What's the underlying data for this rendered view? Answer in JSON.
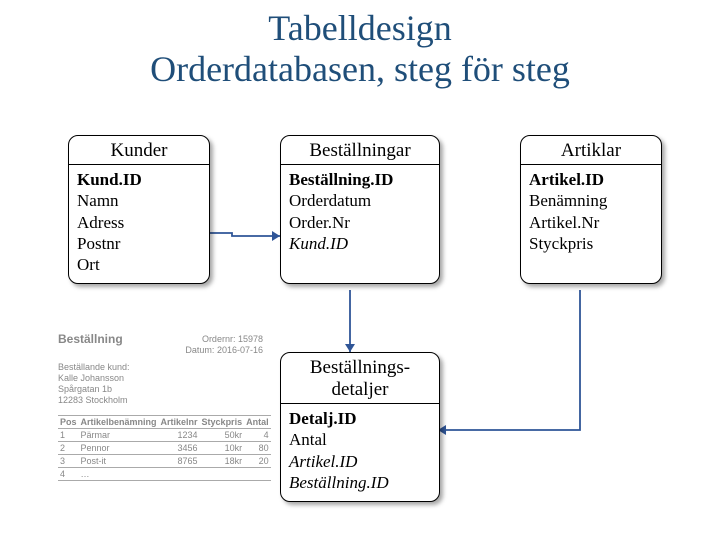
{
  "title_line1": "Tabelldesign",
  "title_line2": "Orderdatabasen, steg för steg",
  "boxes": {
    "kunder": {
      "title": "Kunder",
      "fields": [
        "Kund.ID",
        "Namn",
        "Adress",
        "Postnr",
        "Ort"
      ]
    },
    "bestallningar": {
      "title": "Beställningar",
      "fields": [
        "Beställning.ID",
        "Orderdatum",
        "Order.Nr",
        "Kund.ID"
      ]
    },
    "artiklar": {
      "title": "Artiklar",
      "fields": [
        "Artikel.ID",
        "Benämning",
        "Artikel.Nr",
        "Styckpris"
      ]
    },
    "detaljer": {
      "title_line1": "Beställnings-",
      "title_line2": "detaljer",
      "fields": [
        "Detalj.ID",
        "Antal",
        "Artikel.ID",
        "Beställning.ID"
      ]
    }
  },
  "form": {
    "header": "Beställning",
    "ordernr_label": "Ordernr:",
    "ordernr": "15978",
    "date_label": "Datum:",
    "date": "2016-07-16",
    "addr_label": "Beställande kund:",
    "addr1": "Kalle Johansson",
    "addr2": "Spårgatan 1b",
    "addr3": "12283 Stockholm",
    "cols": [
      "Pos",
      "Artikelbenämning",
      "Artikelnr",
      "Styckpris",
      "Antal"
    ],
    "rows": [
      [
        "1",
        "Pärmar",
        "1234",
        "50kr",
        "4"
      ],
      [
        "2",
        "Pennor",
        "3456",
        "10kr",
        "80"
      ],
      [
        "3",
        "Post-it",
        "8765",
        "18kr",
        "20"
      ],
      [
        "4",
        "…",
        "",
        "",
        ""
      ]
    ]
  }
}
